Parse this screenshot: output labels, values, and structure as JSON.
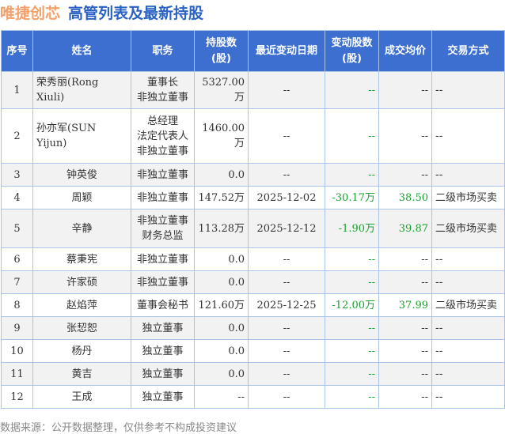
{
  "header": {
    "company": "唯捷创芯",
    "title": "高管列表及最新持股"
  },
  "table": {
    "columns": [
      "序号",
      "姓名",
      "职务",
      "持股数\n(股)",
      "最近变动日期",
      "变动股数\n(股)",
      "成交均价",
      "交易方式"
    ],
    "rows": [
      {
        "no": "1",
        "name": "荣秀丽(Rong Xiuli)",
        "title": [
          "董事长",
          "非独立董事"
        ],
        "shares": "5327.00万",
        "date": "--",
        "change": "--",
        "price": "--",
        "method": "--"
      },
      {
        "no": "2",
        "name": "孙亦军(SUN Yijun)",
        "title": [
          "总经理",
          "法定代表人",
          "非独立董事"
        ],
        "shares": "1460.00万",
        "date": "--",
        "change": "--",
        "price": "--",
        "method": "--"
      },
      {
        "no": "3",
        "name": "钟英俊",
        "title": [
          "非独立董事"
        ],
        "shares": "0.0",
        "date": "--",
        "change": "--",
        "price": "--",
        "method": "--"
      },
      {
        "no": "4",
        "name": "周颖",
        "title": [
          "非独立董事"
        ],
        "shares": "147.52万",
        "date": "2025-12-02",
        "change": "-30.17万",
        "price": "38.50",
        "method": "二级市场买卖"
      },
      {
        "no": "5",
        "name": "辛静",
        "title": [
          "非独立董事",
          "财务总监"
        ],
        "shares": "113.28万",
        "date": "2025-12-12",
        "change": "-1.90万",
        "price": "39.87",
        "method": "二级市场买卖"
      },
      {
        "no": "6",
        "name": "蔡秉宪",
        "title": [
          "非独立董事"
        ],
        "shares": "0.0",
        "date": "--",
        "change": "--",
        "price": "--",
        "method": "--"
      },
      {
        "no": "7",
        "name": "许家硕",
        "title": [
          "非独立董事"
        ],
        "shares": "0.0",
        "date": "--",
        "change": "--",
        "price": "--",
        "method": "--"
      },
      {
        "no": "8",
        "name": "赵焰萍",
        "title": [
          "董事会秘书"
        ],
        "shares": "121.60万",
        "date": "2025-12-25",
        "change": "-12.00万",
        "price": "37.99",
        "method": "二级市场买卖"
      },
      {
        "no": "9",
        "name": "张恝恕",
        "title": [
          "独立董事"
        ],
        "shares": "0.0",
        "date": "--",
        "change": "--",
        "price": "--",
        "method": "--"
      },
      {
        "no": "10",
        "name": "杨丹",
        "title": [
          "独立董事"
        ],
        "shares": "0.0",
        "date": "--",
        "change": "--",
        "price": "--",
        "method": "--"
      },
      {
        "no": "11",
        "name": "黄吉",
        "title": [
          "独立董事"
        ],
        "shares": "0.0",
        "date": "--",
        "change": "--",
        "price": "--",
        "method": "--"
      },
      {
        "no": "12",
        "name": "王成",
        "title": [
          "独立董事"
        ],
        "shares": "--",
        "date": "--",
        "change": "--",
        "price": "--",
        "method": "--"
      }
    ]
  },
  "footer": {
    "source": "数据来源：公开数据整理，仅供参考不构成投资建议"
  },
  "colors": {
    "header_bg": "#3c6fd0",
    "company": "#f4a06a",
    "title": "#2a62c4",
    "negative": "#1aa131",
    "border": "#a9c4e6"
  }
}
